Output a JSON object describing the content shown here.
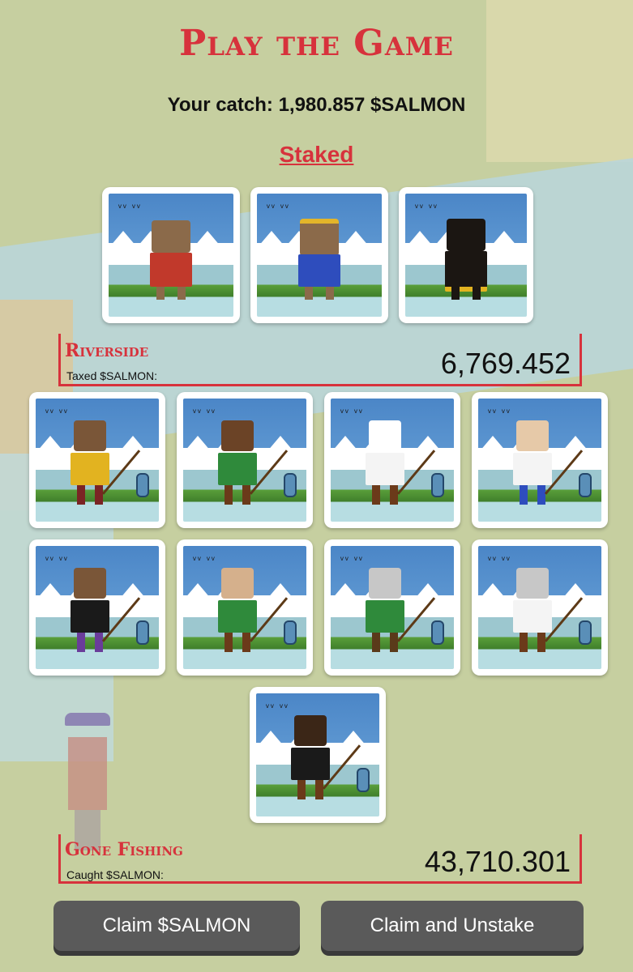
{
  "header": {
    "title": "Play the Game",
    "catch_text": "Your catch: 1,980.857 $SALMON",
    "staked_label": "Staked"
  },
  "riverside": {
    "title": "Riverside",
    "subtitle": "Taxed $SALMON:",
    "value": "6,769.452"
  },
  "gone_fishing": {
    "title": "Gone Fishing",
    "subtitle": "Caught $SALMON:",
    "value": "43,710.301"
  },
  "buttons": {
    "claim": "Claim $SALMON",
    "claim_unstake": "Claim and Unstake"
  },
  "colors": {
    "accent": "#d7323c",
    "button": "#5a5a5a",
    "background": "#c6cfa0"
  },
  "staked_bears": [
    {
      "name": "bear-plaid"
    },
    {
      "name": "bear-superhero"
    },
    {
      "name": "bear-black-gold"
    }
  ],
  "fishermen": [
    {
      "name": "fisher-bear-yellow"
    },
    {
      "name": "fisher-crown"
    },
    {
      "name": "fisher-astronaut"
    },
    {
      "name": "fisher-santa"
    },
    {
      "name": "fisher-bear-tux"
    },
    {
      "name": "fisher-bear-hat"
    },
    {
      "name": "fisher-tinfoil-green"
    },
    {
      "name": "fisher-tinfoil-white"
    },
    {
      "name": "fisher-bear-black-tux"
    }
  ]
}
